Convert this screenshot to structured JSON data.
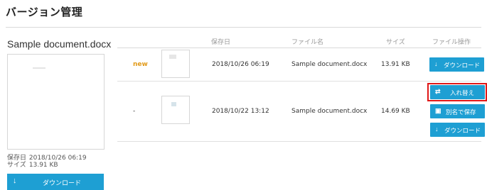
{
  "page": {
    "title": "バージョン管理"
  },
  "current": {
    "name": "Sample document.docx",
    "saved_label": "保存日",
    "saved_value": "2018/10/26 06:19",
    "size_label": "サイズ",
    "size_value": "13.91 KB",
    "download_label": "ダウンロード"
  },
  "table": {
    "headers": [
      "保存日",
      "ファイル名",
      "サイズ",
      "ファイル操作"
    ],
    "rows": [
      {
        "status": "new",
        "saved": "2018/10/26 06:19",
        "name": "Sample document.docx",
        "size": "13.91 KB",
        "actions": {
          "download": "ダウンロード"
        }
      },
      {
        "status": "-",
        "saved": "2018/10/22 13:12",
        "name": "Sample document.docx",
        "size": "14.69 KB",
        "actions": {
          "replace": "入れ替え",
          "save_as": "別名で保存",
          "download": "ダウンロード"
        }
      }
    ]
  },
  "colors": {
    "accent": "#1e9fd3",
    "new_badge": "#e29b1b",
    "highlight": "#e01818"
  }
}
